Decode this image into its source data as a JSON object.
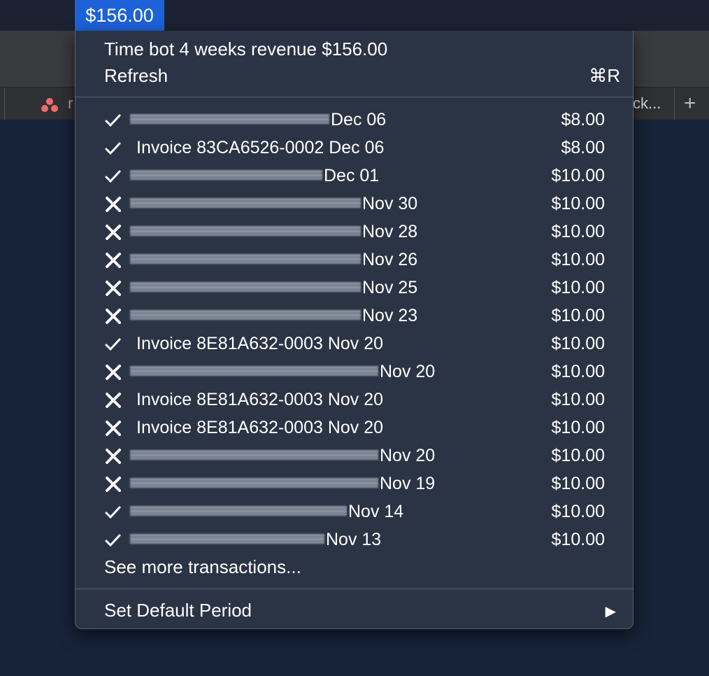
{
  "menubar": {
    "status_item": "$156.00"
  },
  "browser": {
    "tab_left_text": "r",
    "tab_right_text": "ck...",
    "new_tab_symbol": "+"
  },
  "menu": {
    "header_title": "Time bot 4 weeks revenue $156.00",
    "refresh_label": "Refresh",
    "refresh_shortcut": "⌘R",
    "see_more_label": "See more transactions...",
    "default_period_label": "Set Default Period",
    "submenu_arrow": "▶"
  },
  "transactions": [
    {
      "status": "paid",
      "label": "Dec 06",
      "amount": "$8.00",
      "redacted": true
    },
    {
      "status": "paid",
      "label": "Invoice 83CA6526-0002 Dec 06",
      "amount": "$8.00",
      "redacted": false
    },
    {
      "status": "paid",
      "label": "Dec 01",
      "amount": "$10.00",
      "redacted": true
    },
    {
      "status": "failed",
      "label": "Nov 30",
      "amount": "$10.00",
      "redacted": true
    },
    {
      "status": "failed",
      "label": "Nov 28",
      "amount": "$10.00",
      "redacted": true
    },
    {
      "status": "failed",
      "label": "Nov 26",
      "amount": "$10.00",
      "redacted": true
    },
    {
      "status": "failed",
      "label": "Nov 25",
      "amount": "$10.00",
      "redacted": true
    },
    {
      "status": "failed",
      "label": "Nov 23",
      "amount": "$10.00",
      "redacted": true
    },
    {
      "status": "paid",
      "label": "Invoice 8E81A632-0003 Nov 20",
      "amount": "$10.00",
      "redacted": false
    },
    {
      "status": "failed",
      "label": "Nov 20",
      "amount": "$10.00",
      "redacted": true
    },
    {
      "status": "failed",
      "label": "Invoice 8E81A632-0003 Nov 20",
      "amount": "$10.00",
      "redacted": false
    },
    {
      "status": "failed",
      "label": "Invoice 8E81A632-0003 Nov 20",
      "amount": "$10.00",
      "redacted": false
    },
    {
      "status": "failed",
      "label": "Nov 20",
      "amount": "$10.00",
      "redacted": true
    },
    {
      "status": "failed",
      "label": "Nov 19",
      "amount": "$10.00",
      "redacted": true
    },
    {
      "status": "paid",
      "label": "Nov 14",
      "amount": "$10.00",
      "redacted": true
    },
    {
      "status": "paid",
      "label": "Nov 13",
      "amount": "$10.00",
      "redacted": true
    }
  ],
  "colors": {
    "menu_bg": "#2b3444",
    "highlight": "#1d62d8",
    "text": "#ffffff"
  },
  "icons": {
    "paid": "checkmark-icon",
    "failed": "x-mark-icon"
  }
}
